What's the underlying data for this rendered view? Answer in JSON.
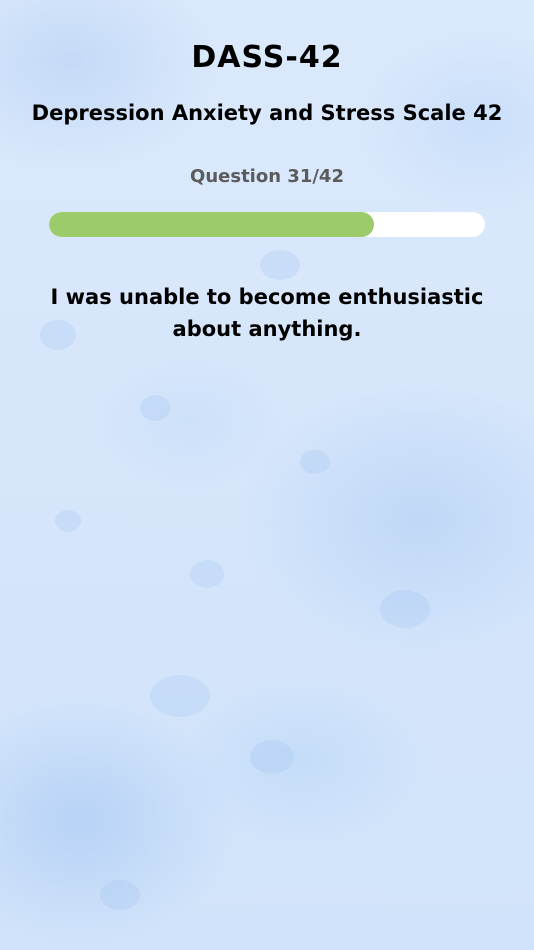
{
  "header": {
    "title": "DASS-42",
    "subtitle": "Depression Anxiety and Stress Scale 42"
  },
  "progress": {
    "label": "Question 31/42",
    "current": 31,
    "total": 42,
    "fraction": 0.745,
    "fill_color": "#9ccb6c",
    "track_color": "#ffffff"
  },
  "question": {
    "text": "I was unable to become enthusiastic about anything."
  },
  "colors": {
    "background": "#d9e8fb",
    "text_primary": "#000000",
    "text_secondary": "#5b5b5b"
  }
}
